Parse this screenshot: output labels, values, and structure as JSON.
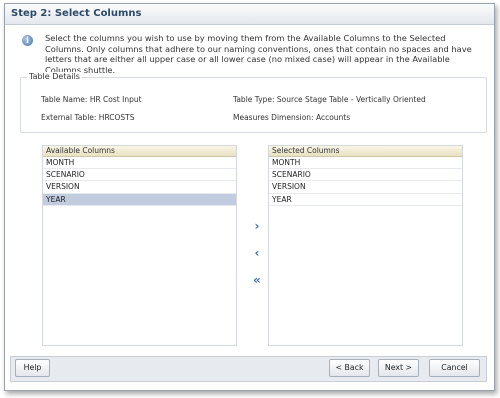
{
  "title": "Step 2: Select Columns",
  "info": {
    "icon": "info-icon",
    "text": "Select the columns you wish to use by moving them from the Available Columns to the Selected Columns. Only columns that adhere to our naming conventions, ones that contain no spaces and have letters that are either all upper case or all lower case (no mixed case) will appear in the Available Columns shuttle."
  },
  "table_details": {
    "legend": "Table Details",
    "table_name": "Table Name: HR Cost Input",
    "table_type": "Table Type: Source Stage Table - Vertically Oriented",
    "external_table": "External Table: HRCOSTS",
    "measures_dimension": "Measures Dimension: Accounts"
  },
  "available": {
    "header": "Available Columns",
    "items": [
      "MONTH",
      "SCENARIO",
      "VERSION",
      "YEAR"
    ],
    "selected_item": "YEAR"
  },
  "selected": {
    "header": "Selected Columns",
    "items": [
      "MONTH",
      "SCENARIO",
      "VERSION",
      "YEAR"
    ]
  },
  "shuttle": {
    "move_right": "›",
    "move_left": "‹",
    "move_all_left": "«"
  },
  "buttons": {
    "help": "Help",
    "back": "< Back",
    "next": "Next >",
    "cancel": "Cancel"
  },
  "colors": {
    "title_text": "#2e4a6a",
    "selected_row": "#c2ccdf",
    "header_bg": "#e8e1c2",
    "shuttle_icon": "#3f73b8"
  }
}
